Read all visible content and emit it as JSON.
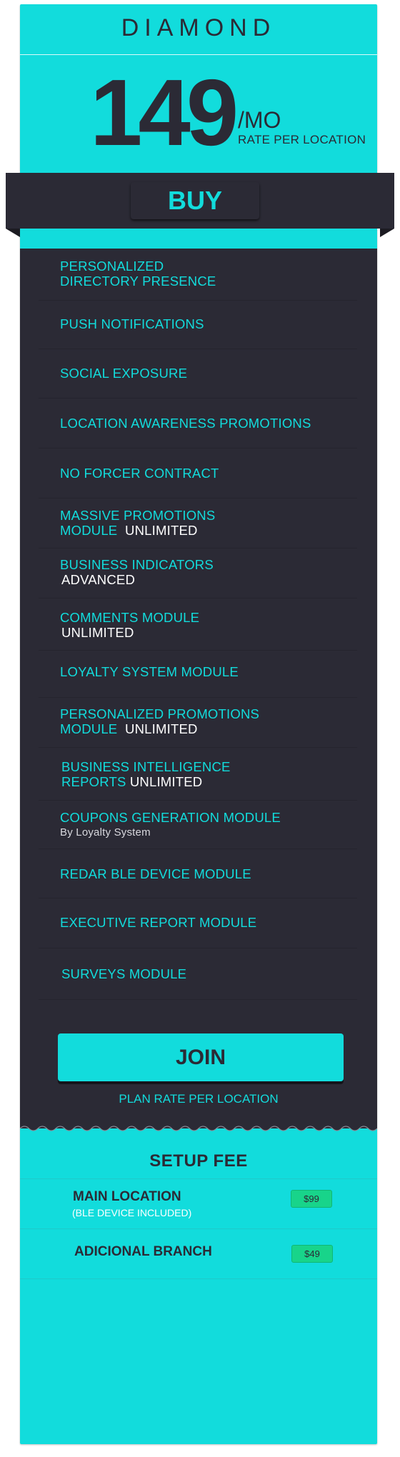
{
  "plan": {
    "name": "DIAMOND",
    "price": "149",
    "period": "/MO",
    "rate_label": "RATE PER LOCATION",
    "buy_label": "BUY"
  },
  "features": [
    {
      "line1": "PERSONALIZED",
      "line2": "DIRECTORY PRESENCE"
    },
    {
      "line1": "PUSH NOTIFICATIONS"
    },
    {
      "line1": "SOCIAL EXPOSURE"
    },
    {
      "line1": "LOCATION AWARENESS PROMOTIONS"
    },
    {
      "line1": "NO FORCER CONTRACT"
    },
    {
      "line1": "MASSIVE PROMOTIONS",
      "line2": "MODULE",
      "highlight": "UNLIMITED"
    },
    {
      "line1": "BUSINESS INDICATORS",
      "highlight": "ADVANCED"
    },
    {
      "line1": "COMMENTS MODULE",
      "highlight": "UNLIMITED"
    },
    {
      "line1": "LOYALTY SYSTEM MODULE"
    },
    {
      "line1": "PERSONALIZED PROMOTIONS",
      "line2": "MODULE",
      "highlight": "UNLIMITED"
    },
    {
      "line1": "BUSINESS INTELLIGENCE",
      "line2": "REPORTS",
      "highlight": "UNLIMITED"
    },
    {
      "line1": "COUPONS GENERATION MODULE",
      "sub": "By Loyalty System"
    },
    {
      "line1": "REDAR BLE DEVICE MODULE"
    },
    {
      "line1": "EXECUTIVE REPORT MODULE"
    },
    {
      "line1": "SURVEYS MODULE"
    }
  ],
  "join": {
    "label": "JOIN",
    "caption": "PLAN RATE PER LOCATION"
  },
  "setup": {
    "title": "SETUP FEE",
    "items": [
      {
        "label": "MAIN LOCATION",
        "note": "(BLE DEVICE INCLUDED)",
        "price": "$99"
      },
      {
        "label": "ADICIONAL BRANCH",
        "price": "$49"
      }
    ]
  },
  "colors": {
    "accent": "#12dcdc",
    "dark": "#2b2a35",
    "badge": "#18d48a"
  }
}
